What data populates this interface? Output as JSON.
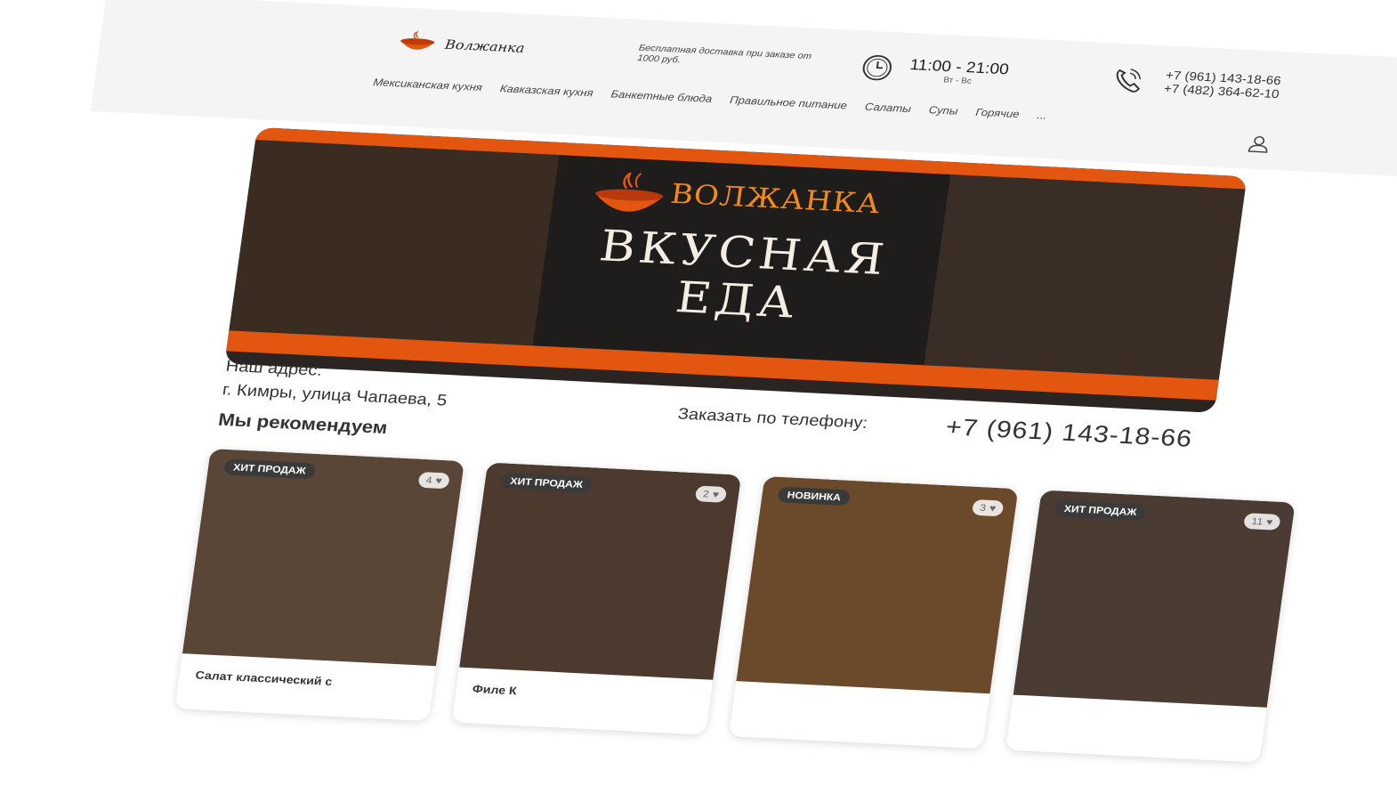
{
  "header": {
    "logo_text": "Волжанка",
    "delivery_text": "Бесплатная доставка при заказе от 1000 руб.",
    "hours": {
      "time": "11:00 - 21:00",
      "days": "Вт - Вс"
    },
    "phones": [
      "+7 (961) 143-18-66",
      "+7 (482) 364-62-10"
    ],
    "nav": [
      "Мексиканская кухня",
      "Кавказская кухня",
      "Банкетные блюда",
      "Правильное питание",
      "Салаты",
      "Супы",
      "Горячие",
      "..."
    ]
  },
  "banner": {
    "brand": "ВОЛЖАНКА",
    "title_line1": "ВКУСНАЯ",
    "title_line2": "ЕДА",
    "address_label": "Наш адрес:",
    "address_value": "г. Кимры, улица Чапаева, 5",
    "order_label": "Заказать по телефону:",
    "order_phone": "+7 (961) 143-18-66"
  },
  "recommend": {
    "title": "Мы рекомендуем",
    "cards": [
      {
        "badge": "ХИТ ПРОДАЖ",
        "likes": "4",
        "name": "Салат классический с",
        "color": "#5a4636"
      },
      {
        "badge": "ХИТ ПРОДАЖ",
        "likes": "2",
        "name": "Филе К",
        "color": "#4b3a2d"
      },
      {
        "badge": "НОВИНКА",
        "likes": "3",
        "name": "",
        "color": "#6b4a2c"
      },
      {
        "badge": "ХИТ ПРОДАЖ",
        "likes": "11",
        "name": "",
        "color": "#4a3b33"
      }
    ]
  },
  "colors": {
    "accent": "#e2560f",
    "brand_orange": "#f28a1b"
  }
}
